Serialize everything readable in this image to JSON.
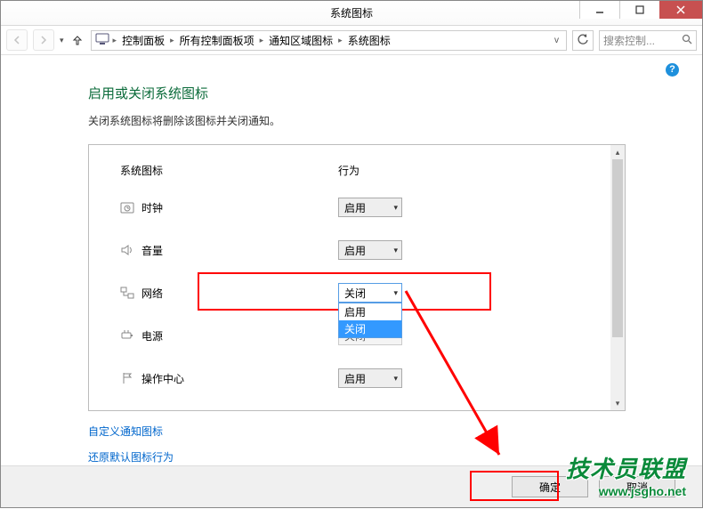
{
  "window": {
    "title": "系统图标"
  },
  "breadcrumb": {
    "items": [
      "控制面板",
      "所有控制面板项",
      "通知区域图标",
      "系统图标"
    ]
  },
  "search": {
    "placeholder": "搜索控制..."
  },
  "page": {
    "heading": "启用或关闭系统图标",
    "subtext": "关闭系统图标将删除该图标并关闭通知。"
  },
  "columns": {
    "icon": "系统图标",
    "behavior": "行为"
  },
  "rows": [
    {
      "id": "clock",
      "label": "时钟",
      "value": "启用"
    },
    {
      "id": "volume",
      "label": "音量",
      "value": "启用"
    },
    {
      "id": "network",
      "label": "网络",
      "value": "关闭",
      "open": true
    },
    {
      "id": "power",
      "label": "电源",
      "value": "关闭"
    },
    {
      "id": "action-center",
      "label": "操作中心",
      "value": "启用"
    }
  ],
  "dropdown": {
    "options": [
      "启用",
      "关闭"
    ],
    "highlighted": "关闭"
  },
  "links": {
    "customize": "自定义通知图标",
    "restore": "还原默认图标行为"
  },
  "buttons": {
    "ok": "确定",
    "cancel": "取消"
  },
  "watermark": {
    "line1": "技术员联盟",
    "line2": "www.jsgho.net"
  }
}
